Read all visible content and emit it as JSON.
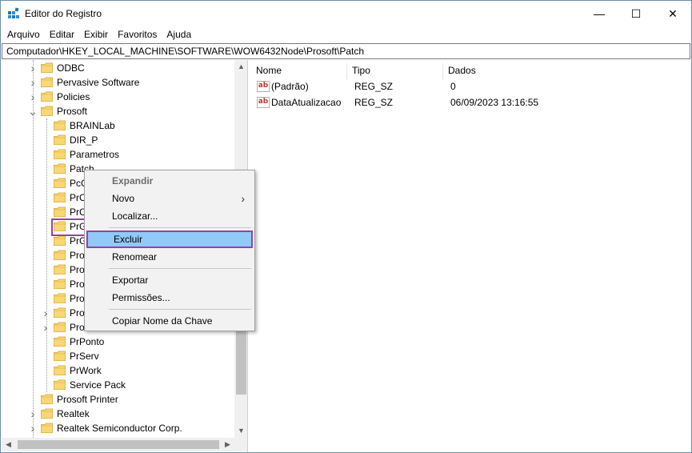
{
  "window": {
    "title": "Editor do Registro",
    "controls": {
      "minimize": "—",
      "maximize": "☐",
      "close": "✕"
    }
  },
  "menubar": [
    "Arquivo",
    "Editar",
    "Exibir",
    "Favoritos",
    "Ajuda"
  ],
  "address": "Computador\\HKEY_LOCAL_MACHINE\\SOFTWARE\\WOW6432Node\\Prosoft\\Patch",
  "tree": {
    "items": [
      {
        "label": "ODBC",
        "expand": "collapsed"
      },
      {
        "label": "Pervasive Software",
        "expand": "collapsed"
      },
      {
        "label": "Policies",
        "expand": "collapsed"
      },
      {
        "label": "Prosoft",
        "expand": "expanded"
      },
      {
        "label": "BRAINLab",
        "expand": "none"
      },
      {
        "label": "DIR_P",
        "expand": "none"
      },
      {
        "label": "Parametros",
        "expand": "none"
      },
      {
        "label": "Patch",
        "expand": "none"
      },
      {
        "label": "PcG",
        "expand": "none"
      },
      {
        "label": "PrC",
        "expand": "none"
      },
      {
        "label": "PrC",
        "expand": "none"
      },
      {
        "label": "PrG",
        "expand": "none"
      },
      {
        "label": "PrG",
        "expand": "none"
      },
      {
        "label": "Pro",
        "expand": "none"
      },
      {
        "label": "Pro",
        "expand": "none"
      },
      {
        "label": "Pro",
        "expand": "none"
      },
      {
        "label": "Pro",
        "expand": "none"
      },
      {
        "label": "Pro",
        "expand": "collapsed"
      },
      {
        "label": "Pro",
        "expand": "collapsed"
      },
      {
        "label": "PrPonto",
        "expand": "none"
      },
      {
        "label": "PrServ",
        "expand": "none"
      },
      {
        "label": "PrWork",
        "expand": "none"
      },
      {
        "label": "Service Pack",
        "expand": "none"
      },
      {
        "label": "Prosoft Printer",
        "expand": "none"
      },
      {
        "label": "Realtek",
        "expand": "collapsed"
      },
      {
        "label": "Realtek Semiconductor Corp.",
        "expand": "collapsed"
      }
    ]
  },
  "list": {
    "columns": [
      "Nome",
      "Tipo",
      "Dados"
    ],
    "rows": [
      {
        "name": "(Padrão)",
        "type": "REG_SZ",
        "data": "0",
        "icon": "string-value-icon"
      },
      {
        "name": "DataAtualizacao",
        "type": "REG_SZ",
        "data": "06/09/2023 13:16:55",
        "icon": "string-value-icon"
      }
    ]
  },
  "context_menu": {
    "items": [
      {
        "label": "Expandir",
        "style": "bold"
      },
      {
        "label": "Novo",
        "submenu": true
      },
      {
        "label": "Localizar..."
      },
      {
        "separator": true
      },
      {
        "label": "Excluir",
        "selected": true
      },
      {
        "label": "Renomear"
      },
      {
        "separator": true
      },
      {
        "label": "Exportar"
      },
      {
        "label": "Permissões..."
      },
      {
        "separator": true
      },
      {
        "label": "Copiar Nome da Chave"
      }
    ]
  },
  "colors": {
    "highlight_border": "#9b3fa8",
    "menu_selection": "#91c9f7",
    "folder_fill": "#f8d775",
    "folder_edge": "#dcb14a"
  }
}
